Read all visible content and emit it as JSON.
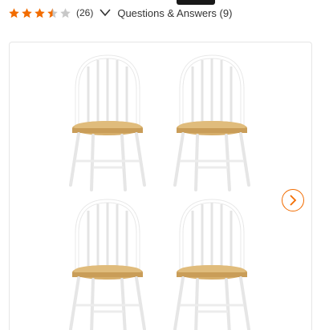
{
  "rating": {
    "value": 3.5,
    "max": 5,
    "review_count": "(26)",
    "star_color": "#f26c00",
    "empty_star_color": "#c8c8c8"
  },
  "questions_answers": {
    "label": "Questions & Answers (9)",
    "icon": "chevron-down-icon"
  },
  "gallery": {
    "image_description_icon": "product-photo",
    "next_icon": "chevron-right-icon",
    "accent_color": "#f26c00"
  }
}
